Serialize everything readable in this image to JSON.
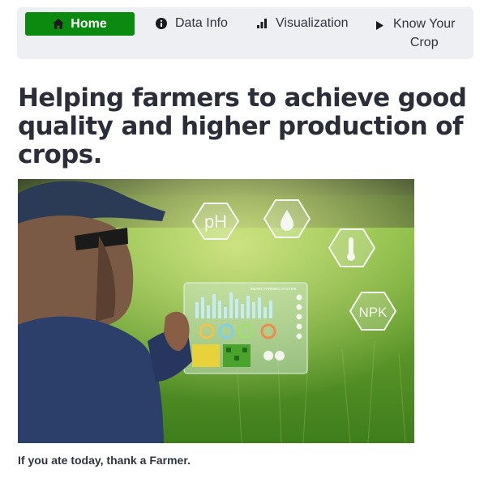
{
  "nav": {
    "home_label": "Home",
    "data_info_label": "Data Info",
    "visualization_label": "Visualization",
    "know_crop_line1": "Know Your",
    "know_crop_line2": "Crop",
    "active_color": "#0a8a0e",
    "icons": [
      "home-icon",
      "info-icon",
      "bar-chart-icon",
      "caret-right-icon"
    ]
  },
  "page": {
    "heading": "Helping farmers to achieve good quality and higher production of crops.",
    "hero_image": {
      "hex_labels": [
        "pH",
        "NPK"
      ],
      "tablet_title": "SMART FARMING SYSTEM"
    },
    "caption": "If you ate today, thank a Farmer."
  }
}
